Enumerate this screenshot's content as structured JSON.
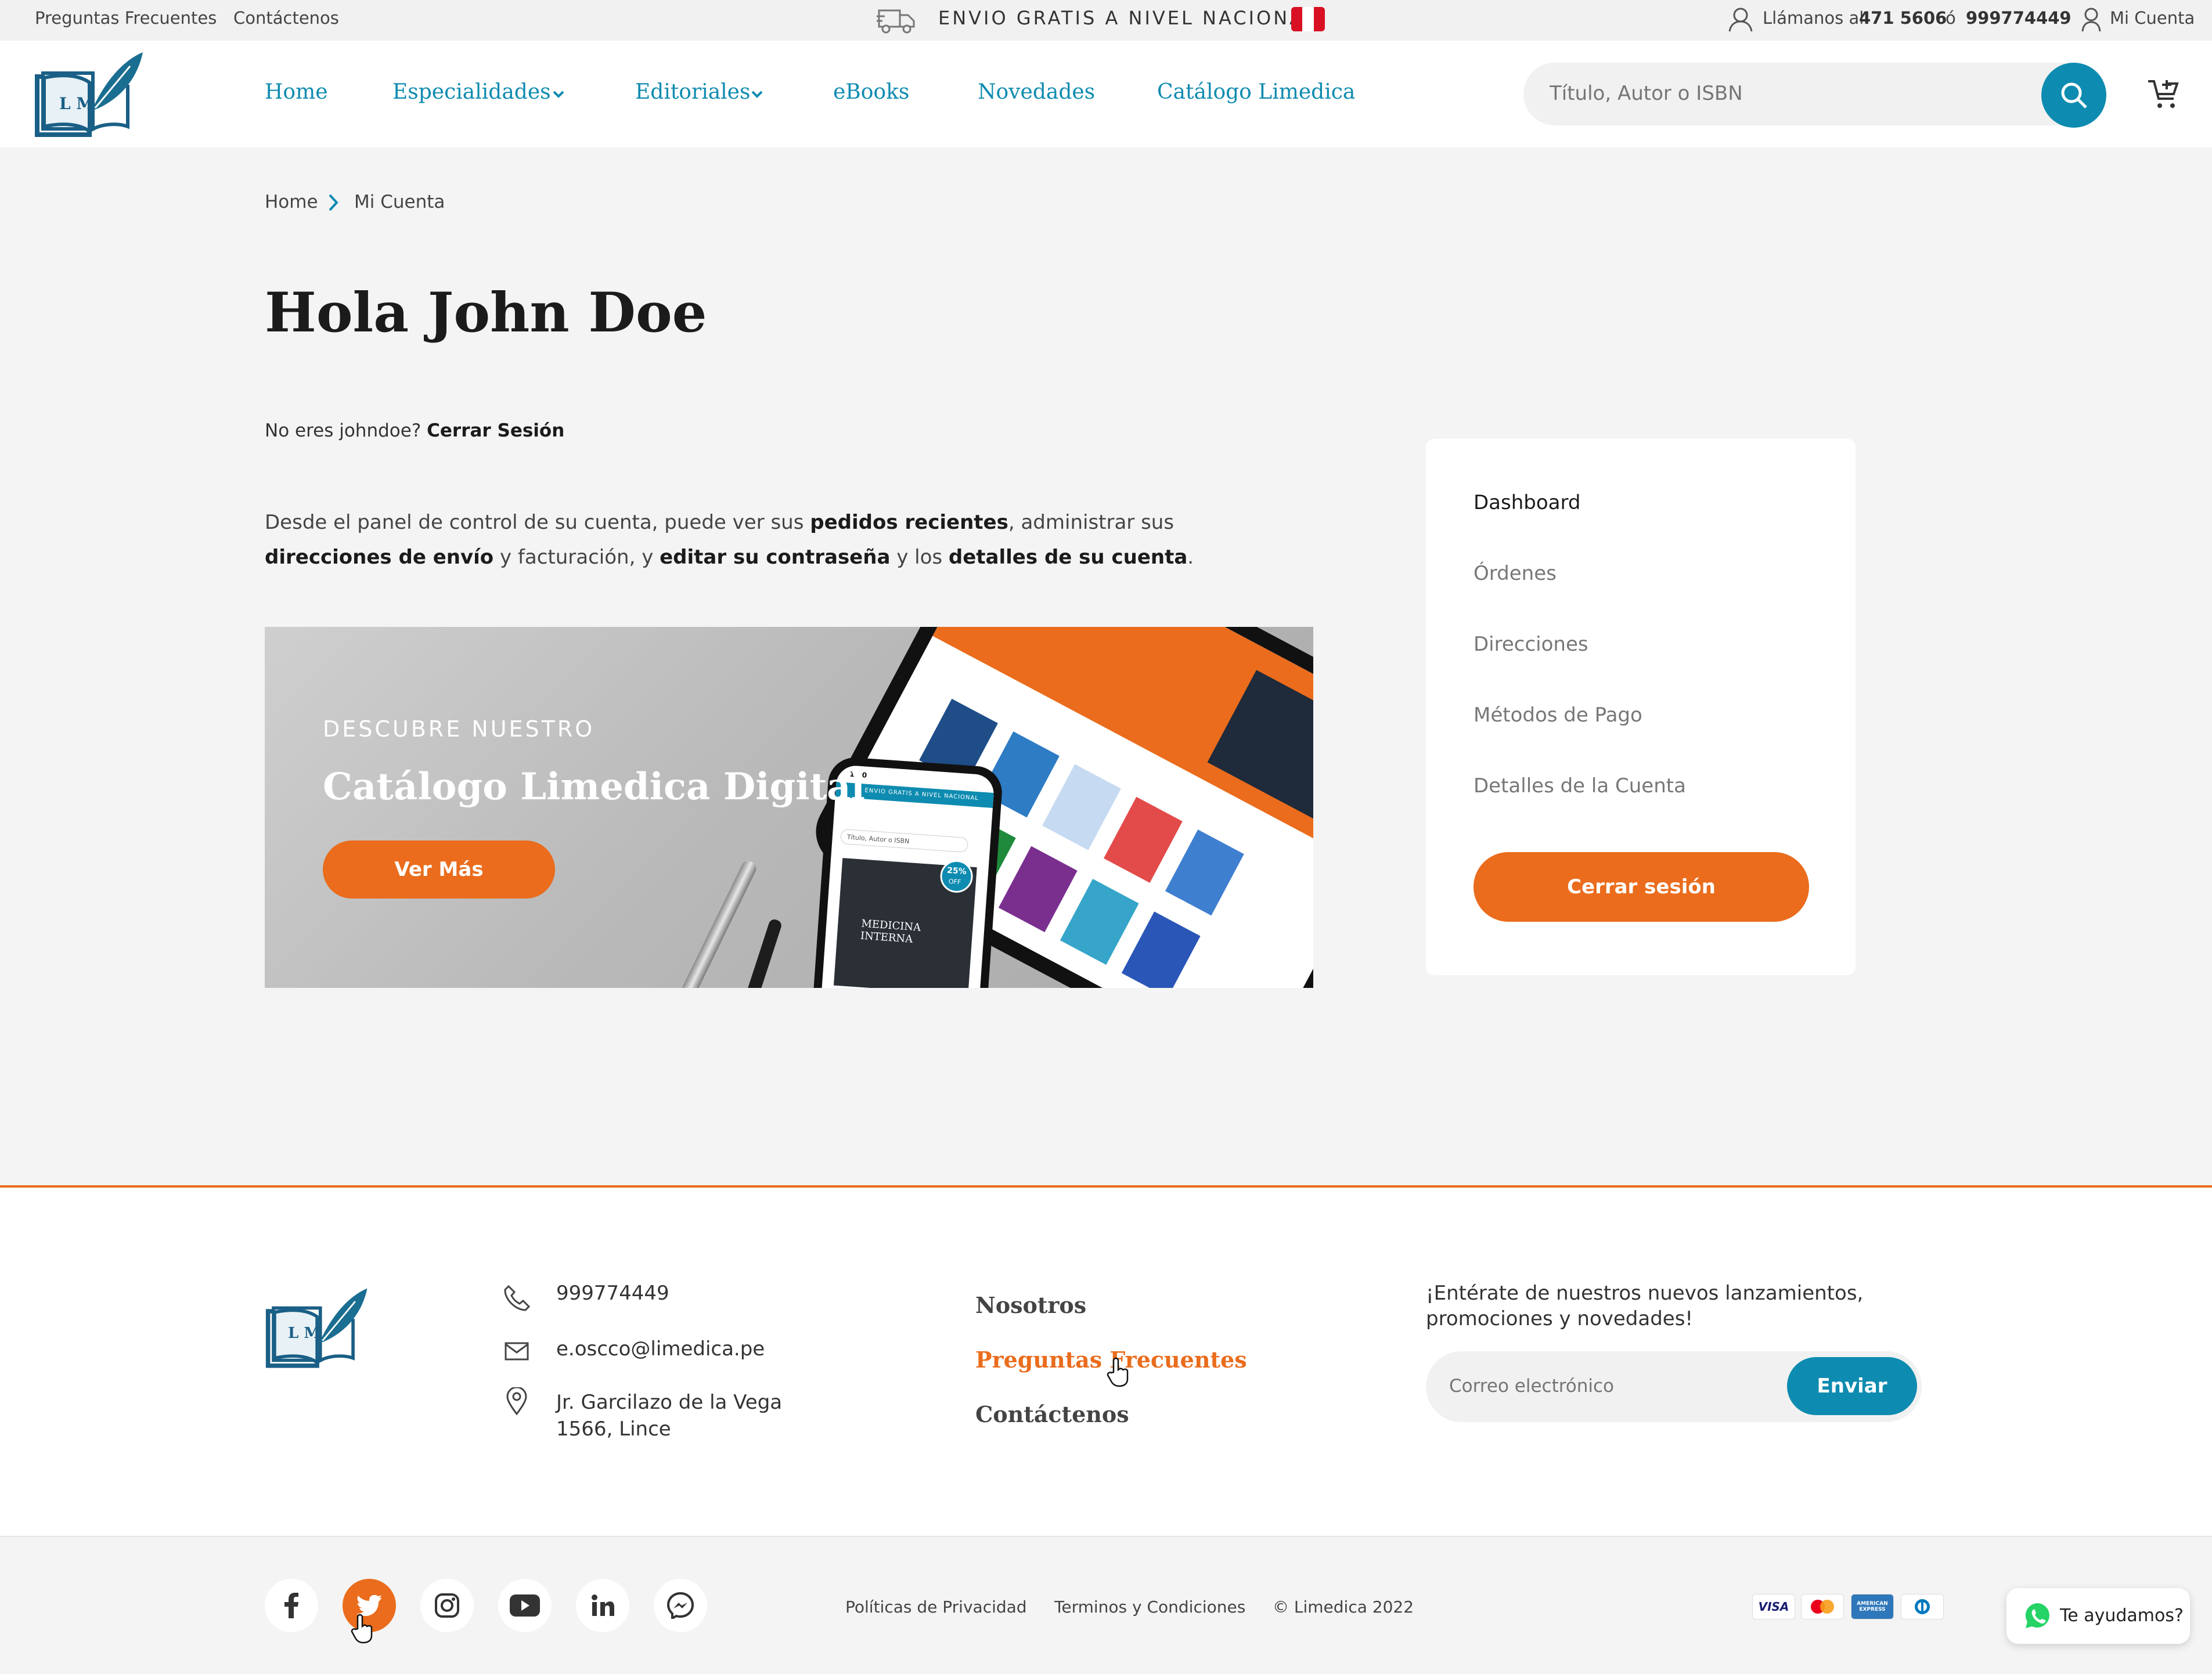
{
  "topbar": {
    "faq": "Preguntas Frecuentes",
    "contact": "Contáctenos",
    "shipping": "ENVIO GRATIS A NIVEL NACIONAL",
    "call_label": "Llámanos al",
    "phone1": "471 5606",
    "or": "ó",
    "phone2": "999774449",
    "account": "Mi Cuenta"
  },
  "brand": {
    "logo_text": "L M"
  },
  "nav": {
    "home": "Home",
    "especialidades": "Especialidades",
    "editoriales": "Editoriales",
    "ebooks": "eBooks",
    "novedades": "Novedades",
    "catalogo": "Catálogo Limedica"
  },
  "search": {
    "placeholder": "Título, Autor o ISBN"
  },
  "breadcrumb": {
    "home": "Home",
    "current": "Mi Cuenta"
  },
  "greeting": {
    "title": "Hola John Doe"
  },
  "notyou": {
    "text": "No eres johndoe?",
    "link": "Cerrar Sesión"
  },
  "intro": {
    "p1": "Desde el panel de control de su cuenta, puede ver sus ",
    "b1": "pedidos recientes",
    "p2": ", administrar sus ",
    "b2": "direcciones de envío",
    "p3": " y facturación, y ",
    "b3": "editar su contraseña",
    "p4": " y los ",
    "b4": "detalles de su cuenta",
    "p5": "."
  },
  "banner": {
    "kicker": "DESCUBRE NUESTRO",
    "title": "Catálogo Limedica Digital",
    "cta": "Ver Más",
    "phone_header": "ENVIO GRATIS A NIVEL NACIONAL",
    "phone_search": "Título, Autor o ISBN",
    "phone_book": "MEDICINA INTERNA",
    "phone_badge_pct": "25%",
    "phone_badge_off": "OFF",
    "phone_time": "1:20"
  },
  "account_menu": {
    "items": [
      "Dashboard",
      "Órdenes",
      "Direcciones",
      "Métodos de Pago",
      "Detalles de la Cuenta"
    ],
    "logout": "Cerrar sesión"
  },
  "footer": {
    "phone": "999774449",
    "email": "e.oscco@limedica.pe",
    "address1": "Jr. Garcilazo de la Vega",
    "address2": "1566, Lince",
    "links": [
      "Nosotros",
      "Preguntas Frecuentes",
      "Contáctenos"
    ],
    "newsletter_text1": "¡Entérate de nuestros nuevos lanzamientos,",
    "newsletter_text2": "promociones y novedades!",
    "newsletter_placeholder": "Correo electrónico",
    "newsletter_button": "Enviar"
  },
  "bottom": {
    "privacy": "Políticas de Privacidad",
    "terms": "Terminos y Condiciones",
    "copyright": "© Limedica 2022",
    "whatsapp": "Te ayudamos?",
    "payments": [
      "VISA",
      "mastercard",
      "AMERICAN EXPRESS",
      "diners"
    ]
  },
  "colors": {
    "teal": "#0e8bb0",
    "orange": "#ea6c1c",
    "dark": "#1b1b1b"
  }
}
